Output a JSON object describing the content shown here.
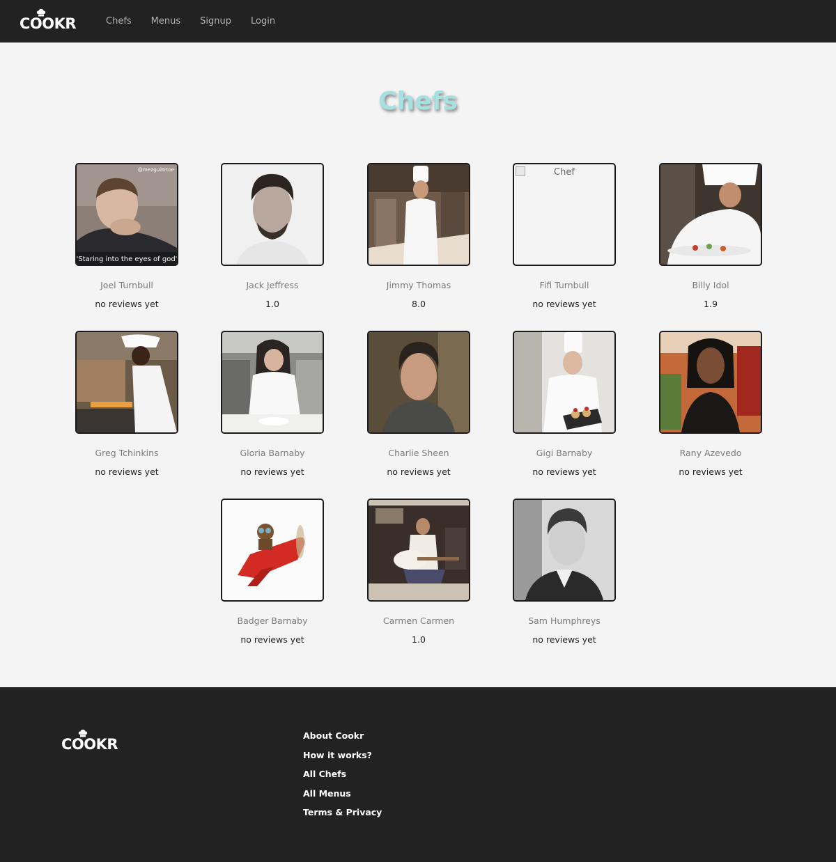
{
  "nav": {
    "logo": "COOKR",
    "links": [
      "Chefs",
      "Menus",
      "Signup",
      "Login"
    ]
  },
  "page_title": "Chefs",
  "chefs": [
    {
      "name": "Joel Turnbull",
      "rating": "no reviews yet",
      "photo_caption": "\"Staring into the eyes of god\"",
      "photo_watermark": "@me2guiltrtoe"
    },
    {
      "name": "Jack Jeffress",
      "rating": "1.0"
    },
    {
      "name": "Jimmy Thomas",
      "rating": "8.0"
    },
    {
      "name": "Fifi Turnbull",
      "rating": "no reviews yet",
      "photo_alt": "Chef"
    },
    {
      "name": "Billy Idol",
      "rating": "1.9"
    },
    {
      "name": "Greg Tchinkins",
      "rating": "no reviews yet"
    },
    {
      "name": "Gloria Barnaby",
      "rating": "no reviews yet"
    },
    {
      "name": "Charlie Sheen",
      "rating": "no reviews yet"
    },
    {
      "name": "Gigi Barnaby",
      "rating": "no reviews yet"
    },
    {
      "name": "Rany Azevedo",
      "rating": "no reviews yet"
    },
    {
      "name": "Badger Barnaby",
      "rating": "no reviews yet"
    },
    {
      "name": "Carmen Carmen",
      "rating": "1.0"
    },
    {
      "name": "Sam Humphreys",
      "rating": "no reviews yet"
    }
  ],
  "footer": {
    "logo": "COOKR",
    "links": [
      "About Cookr",
      "How it works?",
      "All Chefs",
      "All Menus",
      "Terms & Privacy"
    ]
  },
  "colors": {
    "nav_bg": "#222222",
    "page_bg": "#f4f4f4",
    "title": "#a6e0e0",
    "name_text": "#7a7a7a",
    "rating_text": "#222222"
  }
}
